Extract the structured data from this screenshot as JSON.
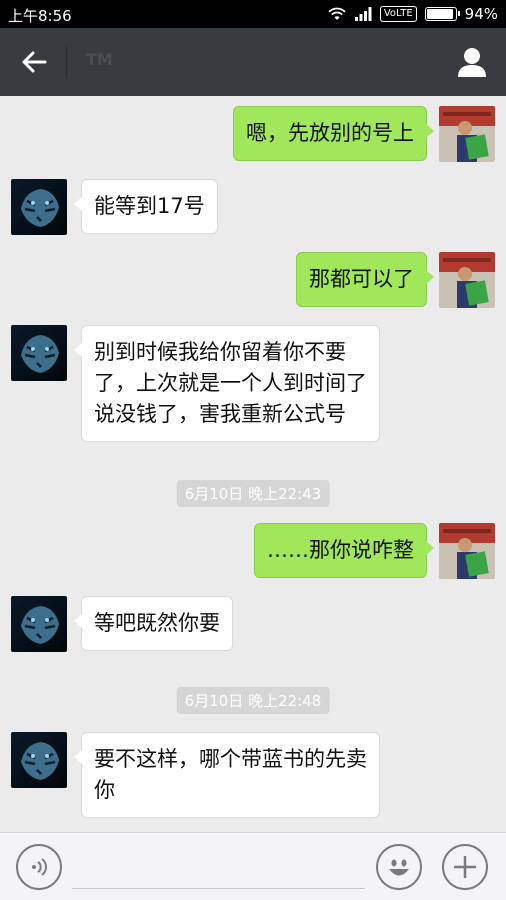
{
  "status_bar": {
    "time": "上午8:56",
    "network": "VoLTE",
    "battery": "94%",
    "battery_level": 0.94
  },
  "header": {
    "title": "TM",
    "back_icon": "back-arrow-icon",
    "profile_icon": "person-icon"
  },
  "messages": [
    {
      "side": "right",
      "text": "嗯，先放别的号上",
      "avatar": "own-avatar"
    },
    {
      "side": "left",
      "text": "能等到17号",
      "avatar": "tiger-avatar"
    },
    {
      "side": "right",
      "text": "那都可以了",
      "avatar": "own-avatar"
    },
    {
      "side": "left",
      "lines": [
        "别到时候我给你留着你不要",
        "了，上次就是一个人到时间了",
        "说没钱了，害我重新公式号"
      ],
      "avatar": "tiger-avatar"
    },
    {
      "timestamp": "6月10日 晚上22:43"
    },
    {
      "side": "right",
      "text": "……那你说咋整",
      "avatar": "own-avatar"
    },
    {
      "side": "left",
      "text": "等吧既然你要",
      "avatar": "tiger-avatar"
    },
    {
      "timestamp": "6月10日 晚上22:48"
    },
    {
      "side": "left",
      "lines": [
        "要不这样，哪个带蓝书的先卖",
        "你"
      ],
      "avatar": "tiger-avatar"
    }
  ],
  "input_bar": {
    "voice_icon": "voice-icon",
    "placeholder": "",
    "emoji_icon": "emoji-icon",
    "plus_icon": "plus-icon"
  },
  "colors": {
    "sent_bubble": "#a0e75a",
    "received_bubble": "#ffffff",
    "title_bar": "#383b3f",
    "chat_bg": "#ebebeb"
  }
}
